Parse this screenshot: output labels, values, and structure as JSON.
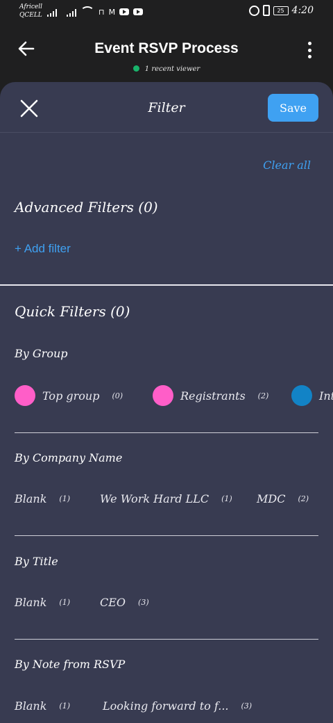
{
  "status_bar": {
    "carrier": "Africell QCELL",
    "battery": "25",
    "time": "4:20"
  },
  "app_header": {
    "title": "Event RSVP Process",
    "viewer_text": "1 recent viewer",
    "viewer_dot_color": "#19b36b"
  },
  "filter_sheet": {
    "title": "Filter",
    "save_label": "Save",
    "clear_all_label": "Clear all",
    "advanced_title": "Advanced Filters (0)",
    "add_filter_label": "+ Add filter",
    "quick_title": "Quick Filters (0)"
  },
  "groups": {
    "title": "By Group",
    "items": [
      {
        "label": "Top group",
        "count": "(0)",
        "color": "#ff5ec8"
      },
      {
        "label": "Registrants",
        "count": "(2)",
        "color": "#ff5ec8"
      },
      {
        "label": "Int",
        "count": "",
        "color": "#1283c6"
      }
    ]
  },
  "company": {
    "title": "By Company Name",
    "items": [
      {
        "label": "Blank",
        "count": "(1)"
      },
      {
        "label": "We Work Hard LLC",
        "count": "(1)"
      },
      {
        "label": "MDC",
        "count": "(2)"
      }
    ]
  },
  "job_title": {
    "title": "By Title",
    "items": [
      {
        "label": "Blank",
        "count": "(1)"
      },
      {
        "label": "CEO",
        "count": "(3)"
      }
    ]
  },
  "rsvp_note": {
    "title": "By Note from RSVP",
    "items": [
      {
        "label": "Blank",
        "count": "(1)"
      },
      {
        "label": "Looking forward to f...",
        "count": "(3)"
      }
    ]
  },
  "colors": {
    "accent": "#3fa1f2",
    "sheet_bg": "#383b51",
    "header_bg": "#1f1f20"
  }
}
